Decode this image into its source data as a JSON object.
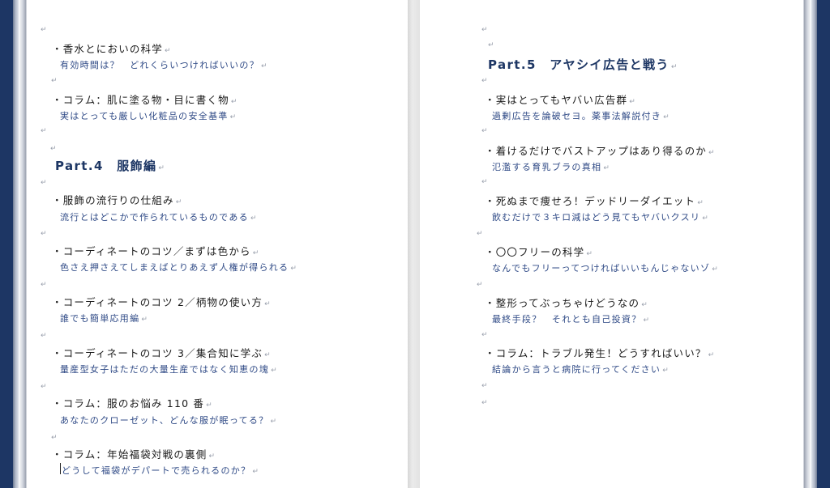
{
  "return_mark": "↵",
  "left_page": {
    "entries": [
      {
        "title": "・香水とにおいの科学",
        "subtitle": "有効時間は？　どれくらいつければいいの？"
      },
      {
        "title": "・コラム：肌に塗る物・目に書く物",
        "subtitle": "実はとっても厳しい化粧品の安全基準"
      }
    ],
    "heading": "Part.4　服飾編",
    "section_entries": [
      {
        "title": "・服飾の流行りの仕組み",
        "subtitle": "流行とはどこかで作られているものである"
      },
      {
        "title": "・コーディネートのコツ／まずは色から",
        "subtitle": "色さえ押さえてしまえばとりあえず人権が得られる"
      },
      {
        "title": "・コーディネートのコツ 2／柄物の使い方",
        "subtitle": "誰でも簡単応用編"
      },
      {
        "title": "・コーディネートのコツ 3／集合知に学ぶ",
        "subtitle": "量産型女子はただの大量生産ではなく知恵の塊"
      },
      {
        "title": "・コラム：服のお悩み 110 番",
        "subtitle": "あなたのクローゼット、どんな服が眠ってる？"
      },
      {
        "title": "・コラム：年始福袋対戦の裏側",
        "subtitle": "どうして福袋がデパートで売られるのか？"
      }
    ]
  },
  "right_page": {
    "heading": "Part.5　アヤシイ広告と戦う",
    "entries": [
      {
        "title": "・実はとってもヤバい広告群",
        "subtitle": "過剰広告を論破セヨ。薬事法解説付き"
      },
      {
        "title": "・着けるだけでバストアップはあり得るのか",
        "subtitle": "氾濫する育乳ブラの真相"
      },
      {
        "title": "・死ぬまで痩せろ！デッドリーダイエット",
        "subtitle": "飲むだけで３キロ減はどう見てもヤバいクスリ"
      },
      {
        "title": "・〇〇フリーの科学",
        "subtitle": "なんでもフリーってつければいいもんじゃないゾ"
      },
      {
        "title": "・整形ってぶっちゃけどうなの",
        "subtitle": "最終手段？　それとも自己投資？"
      },
      {
        "title": "・コラム：トラブル発生！どうすればいい？",
        "subtitle": "結論から言うと病院に行ってください"
      }
    ]
  }
}
